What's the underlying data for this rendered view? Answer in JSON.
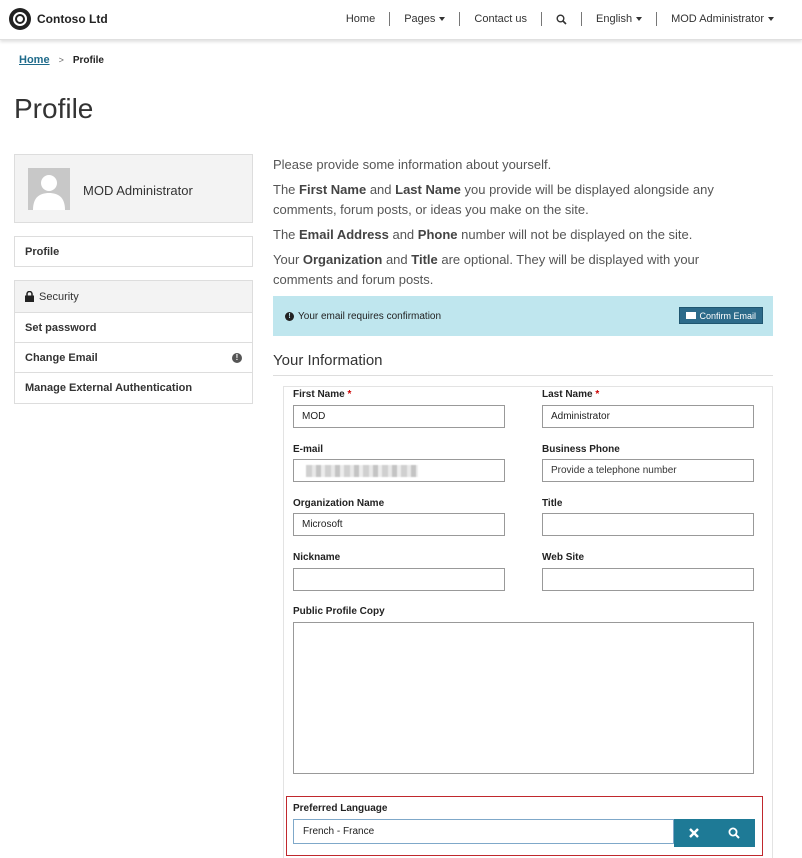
{
  "header": {
    "brand": "Contoso Ltd",
    "nav": {
      "home": "Home",
      "pages": "Pages",
      "contact": "Contact us",
      "language": "English",
      "user": "MOD Administrator"
    }
  },
  "breadcrumb": {
    "home": "Home",
    "separator": ">",
    "current": "Profile"
  },
  "page_title": "Profile",
  "sidebar": {
    "user_name": "MOD Administrator",
    "profile": "Profile",
    "security_heading": "Security",
    "links": {
      "set_password": "Set password",
      "change_email": "Change Email",
      "manage_external": "Manage External Authentication"
    }
  },
  "intro": {
    "line1": "Please provide some information about yourself.",
    "p2": {
      "a": "The ",
      "b1": "First Name",
      "c": " and ",
      "b2": "Last Name",
      "d": " you provide will be displayed alongside any comments, forum posts, or ideas you make on the site."
    },
    "p3": {
      "a": "The ",
      "b1": "Email Address",
      "c": " and ",
      "b2": "Phone",
      "d": " number will not be displayed on the site."
    },
    "p4": {
      "a": "Your ",
      "b1": "Organization",
      "c": " and ",
      "b2": "Title",
      "d": " are optional. They will be displayed with your comments and forum posts."
    }
  },
  "alert": {
    "message": "Your email requires confirmation",
    "button": "Confirm Email"
  },
  "section_title": "Your Information",
  "form": {
    "first_name": {
      "label": "First Name",
      "required": "*",
      "value": "MOD"
    },
    "last_name": {
      "label": "Last Name",
      "required": "*",
      "value": "Administrator"
    },
    "email": {
      "label": "E-mail"
    },
    "business_phone": {
      "label": "Business Phone",
      "placeholder": "Provide a telephone number"
    },
    "organization": {
      "label": "Organization Name",
      "value": "Microsoft"
    },
    "title": {
      "label": "Title",
      "value": ""
    },
    "nickname": {
      "label": "Nickname",
      "value": ""
    },
    "website": {
      "label": "Web Site",
      "value": ""
    },
    "public_profile": {
      "label": "Public Profile Copy",
      "value": ""
    },
    "preferred_language": {
      "label": "Preferred Language",
      "value": "French - France"
    }
  }
}
